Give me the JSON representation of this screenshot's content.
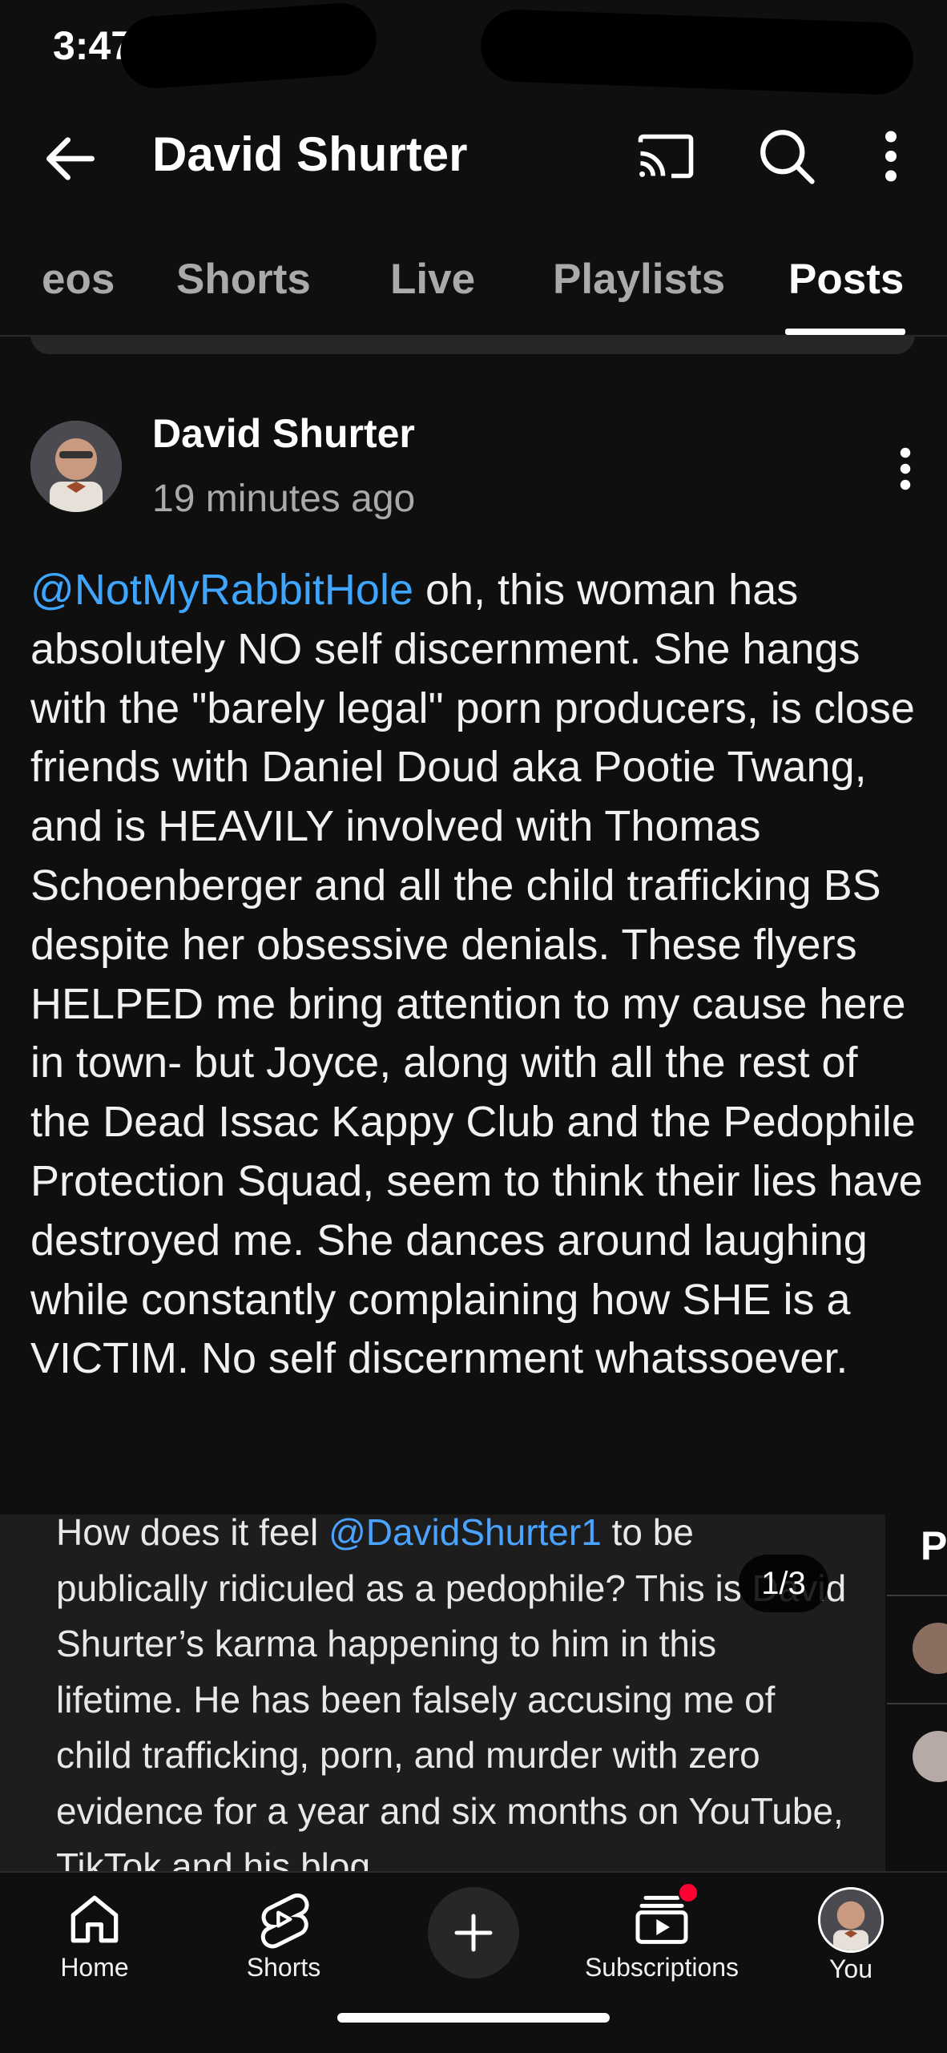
{
  "status_bar": {
    "time": "3:47"
  },
  "header": {
    "title": "David Shurter",
    "icons": [
      "back-arrow-icon",
      "cast-icon",
      "search-icon",
      "more-vert-icon"
    ]
  },
  "tabs": [
    {
      "label": "eos",
      "active": false
    },
    {
      "label": "Shorts",
      "active": false
    },
    {
      "label": "Live",
      "active": false
    },
    {
      "label": "Playlists",
      "active": false
    },
    {
      "label": "Posts",
      "active": true
    }
  ],
  "post": {
    "author": "David Shurter",
    "time": "19 minutes ago",
    "mention": "@NotMyRabbitHole",
    "text": " oh, this woman has absolutely NO self discernment. She hangs with the \"barely legal\" porn producers, is close friends with Daniel Doud aka Pootie Twang, and is HEAVILY involved with Thomas Schoenberger and all the child trafficking BS despite her obsessive denials. These flyers HELPED me bring attention to my cause here in town- but Joyce, along with all the rest of the Dead Issac Kappy Club and the Pedophile Protection Squad, seem to think their lies have destroyed me. She dances around laughing while constantly complaining how SHE is a VICTIM. No self discernment whatssoever.",
    "image": {
      "counter": "1/3",
      "text_before": "How does it feel ",
      "mention": "@DavidShurter1",
      "text_after": " to be publically ridiculed as a pedophile?  This is David Shurter’s karma happening to him in this lifetime.  He has been falsely accusing me of child trafficking, porn, and murder with zero evidence for a year and six months on YouTube, TikTok and his blog",
      "next_slide_letter": "P"
    }
  },
  "bottom_nav": {
    "items": [
      {
        "label": "Home",
        "icon": "home-icon"
      },
      {
        "label": "Shorts",
        "icon": "shorts-icon"
      },
      {
        "label": "",
        "icon": "create-plus-icon"
      },
      {
        "label": "Subscriptions",
        "icon": "subscriptions-icon"
      },
      {
        "label": "You",
        "icon": "avatar"
      }
    ]
  },
  "colors": {
    "background": "#0f0f0f",
    "mention": "#3ea6ff",
    "notification": "#ff0033"
  }
}
